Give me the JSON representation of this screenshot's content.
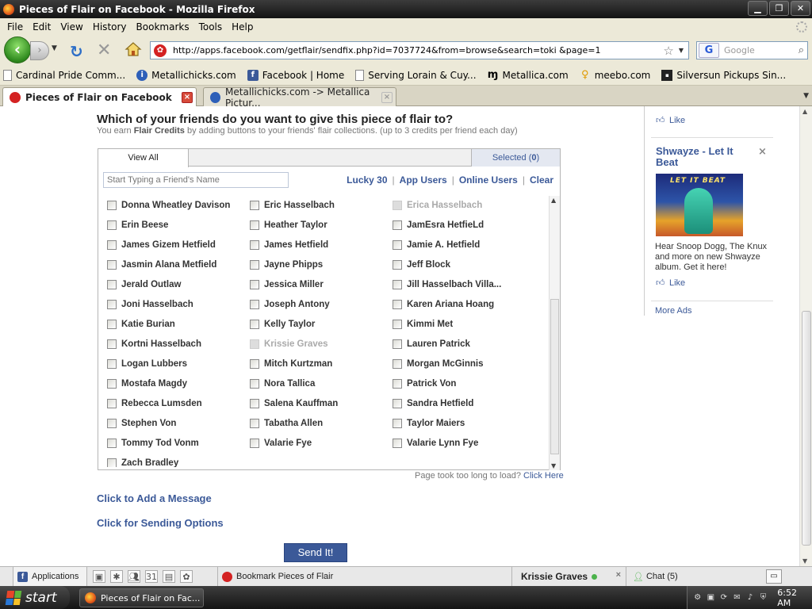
{
  "window": {
    "title": "Pieces of Flair on Facebook - Mozilla Firefox"
  },
  "menu": [
    "File",
    "Edit",
    "View",
    "History",
    "Bookmarks",
    "Tools",
    "Help"
  ],
  "navbar": {
    "url": "http://apps.facebook.com/getflair/sendfix.php?id=7037724&from=browse&search=toki &page=1",
    "search_placeholder": "Google"
  },
  "bookmarks": [
    {
      "label": "Cardinal Pride Comm...",
      "icon": "page-icon"
    },
    {
      "label": "Metallichicks.com",
      "icon": "info-icon"
    },
    {
      "label": "Facebook | Home",
      "icon": "facebook-icon"
    },
    {
      "label": "Serving Lorain & Cuy...",
      "icon": "page-icon"
    },
    {
      "label": "Metallica.com",
      "icon": "metallica-icon"
    },
    {
      "label": "meebo.com",
      "icon": "meebo-icon"
    },
    {
      "label": "Silversun Pickups Sin...",
      "icon": "site-icon"
    }
  ],
  "tabs": [
    {
      "label": "Pieces of Flair on Facebook",
      "active": true
    },
    {
      "label": "Metallichicks.com -> Metallica Pictur...",
      "active": false
    }
  ],
  "page": {
    "heading": "Which of your friends do you want to give this piece of flair to?",
    "sub_pre": "You earn ",
    "sub_bold": "Flair Credits",
    "sub_post": " by adding buttons to your friends' flair collections. (up to 3 credits per friend each day)",
    "tab_view_all": "View All",
    "tab_selected_label": "Selected (",
    "tab_selected_count": "0",
    "tab_selected_close": ")",
    "friend_placeholder": "Start Typing a Friend's Name",
    "filters": [
      "Lucky 30",
      "App Users",
      "Online Users",
      "Clear"
    ],
    "slow_text": "Page took too long to load? ",
    "slow_link": "Click Here",
    "add_message": "Click to Add a Message",
    "send_options": "Click for Sending Options",
    "send_button": "Send It!"
  },
  "friends": [
    [
      "Donna Wheatley Davison",
      "Eric Hasselbach",
      "Erica Hasselbach"
    ],
    [
      "Erin Beese",
      "Heather Taylor",
      "JamEsra HetfieLd"
    ],
    [
      "James Gizem Hetfield",
      "James Hetfield",
      "Jamie A. Hetfield"
    ],
    [
      "Jasmin Alana Metfield",
      "Jayne Phipps",
      "Jeff Block"
    ],
    [
      "Jerald Outlaw",
      "Jessica Miller",
      "Jill Hasselbach Villa..."
    ],
    [
      "Joni Hasselbach",
      "Joseph Antony",
      "Karen Ariana Hoang"
    ],
    [
      "Katie Burian",
      "Kelly Taylor",
      "Kimmi Met"
    ],
    [
      "Kortni Hasselbach",
      "Krissie Graves",
      "Lauren Patrick"
    ],
    [
      "Logan Lubbers",
      "Mitch Kurtzman",
      "Morgan McGinnis"
    ],
    [
      "Mostafa Magdy",
      "Nora Tallica",
      "Patrick Von"
    ],
    [
      "Rebecca Lumsden",
      "Salena Kauffman",
      "Sandra Hetfield"
    ],
    [
      "Stephen Von",
      "Tabatha Allen",
      "Taylor Maiers"
    ],
    [
      "Tommy Tod Vonm",
      "Valarie Fye",
      "Valarie Lynn Fye"
    ],
    [
      "Zach Bradley"
    ]
  ],
  "disabled_friends": [
    "Erica Hasselbach",
    "Krissie Graves"
  ],
  "ads": {
    "top_like": "Like",
    "title": "Shwayze - Let It Beat",
    "image_logo": "LET IT BEAT",
    "body": "Hear Snoop Dogg, The Knux and more on new Shwayze album. Get it here!",
    "like": "Like",
    "more": "More Ads"
  },
  "fbbar": {
    "applications": "Applications",
    "bookmark": "Bookmark Pieces of Flair",
    "chat_name": "Krissie Graves",
    "chat": "Chat (5)"
  },
  "taskbar": {
    "start": "start",
    "task": "Pieces of Flair on Fac...",
    "clock": "6:52 AM"
  },
  "colors": {
    "facebook_blue": "#3b5998",
    "online_green": "#4cb34c"
  }
}
